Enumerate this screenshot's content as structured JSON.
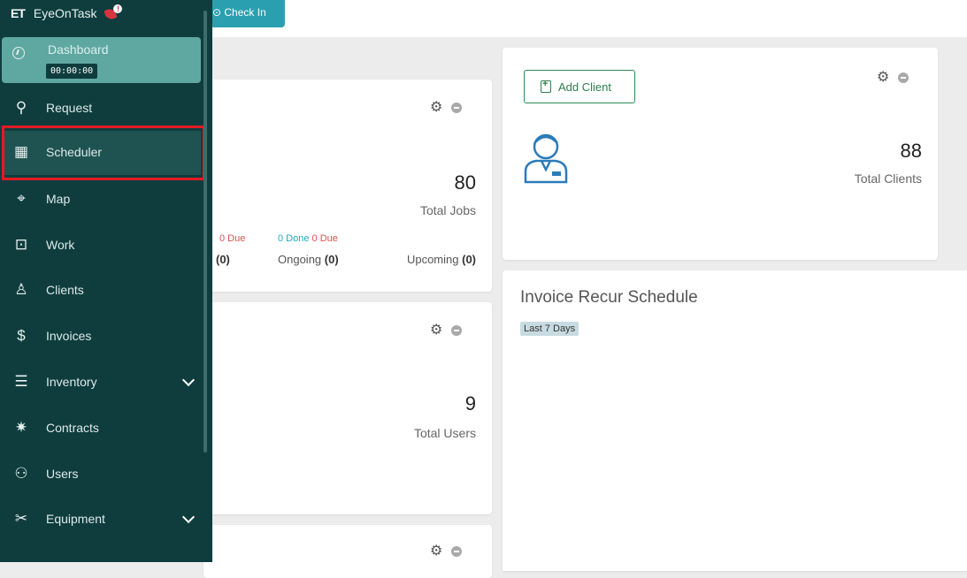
{
  "topbar": {
    "checkin_label": "⊙ Check In"
  },
  "sidebar": {
    "brand_short": "ET",
    "brand_name": "EyeOnTask",
    "dashboard": {
      "label": "Dashboard",
      "timer": "00:00:00"
    },
    "items": [
      {
        "label": "Request",
        "icon": "request-icon",
        "glyph": "⚲"
      },
      {
        "label": "Scheduler",
        "icon": "calendar-icon",
        "glyph": "▦"
      },
      {
        "label": "Map",
        "icon": "map-pin-icon",
        "glyph": "⌖"
      },
      {
        "label": "Work",
        "icon": "briefcase-icon",
        "glyph": "⊡"
      },
      {
        "label": "Clients",
        "icon": "user-icon",
        "glyph": "♙"
      },
      {
        "label": "Invoices",
        "icon": "invoice-icon",
        "glyph": "$"
      },
      {
        "label": "Inventory",
        "icon": "inventory-icon",
        "glyph": "☰"
      },
      {
        "label": "Contracts",
        "icon": "handshake-icon",
        "glyph": "✷"
      },
      {
        "label": "Users",
        "icon": "users-icon",
        "glyph": "⚇"
      },
      {
        "label": "Equipment",
        "icon": "tools-icon",
        "glyph": "✂"
      }
    ]
  },
  "jobs_card": {
    "total": "80",
    "total_label": "Total Jobs",
    "stat1": {
      "due": "0 Due",
      "label": "",
      "value": "(0)"
    },
    "stat2": {
      "done": "0 Done",
      "due": "0 Due",
      "label": "Ongoing",
      "value": "(0)"
    },
    "stat3": {
      "label": "Upcoming",
      "value": "(0)"
    }
  },
  "users_card": {
    "total": "9",
    "total_label": "Total Users"
  },
  "clients_card": {
    "add_label": "Add Client",
    "total": "88",
    "total_label": "Total Clients"
  },
  "invoice_card": {
    "title": "Invoice Recur Schedule",
    "range_badge": "Last 7 Days"
  }
}
